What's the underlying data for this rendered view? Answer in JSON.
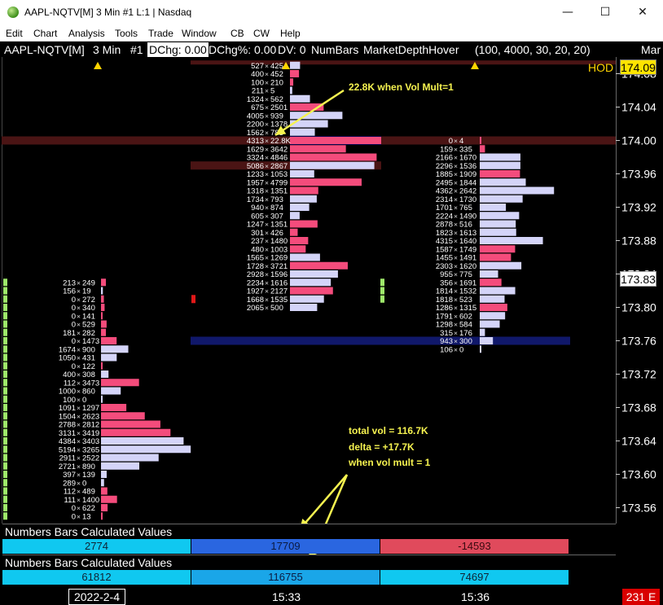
{
  "window": {
    "title": "AAPL-NQTV[M]  3 Min  #1 L:1 | Nasdaq",
    "minimize": "—",
    "maximize": "☐",
    "close": "✕"
  },
  "menu": [
    "Edit",
    "Chart",
    "Analysis",
    "Tools",
    "Trade",
    "Window",
    "CB",
    "CW",
    "Help"
  ],
  "infobar": {
    "symbol": "AAPL-NQTV[M]",
    "interval": "3 Min",
    "chart_num": "#1",
    "dchg": "DChg: 0.00",
    "dchg_pct": "DChg%: 0.00",
    "dv": "DV: 0",
    "study": "NumBars",
    "study2": "MarketDepthHover",
    "params": "(100, 4000, 30, 20, 20)",
    "trailing": "Mar"
  },
  "price_axis": {
    "labels": [
      "174.08",
      "174.04",
      "174.00",
      "173.96",
      "173.92",
      "173.88",
      "173.84",
      "173.80",
      "173.76",
      "173.72",
      "173.68",
      "173.64",
      "173.60",
      "173.56"
    ],
    "hod_label": "HOD",
    "hod_price": "174.09",
    "current_price": "173.83"
  },
  "colors": {
    "ask_bar": "#f44c7c",
    "bid_bar": "#d4d4f8",
    "poc_row": "#4a1414",
    "blue_row": "#0a0aa0",
    "navy_row": "#10186a",
    "cyan": "#10c8f0",
    "blue": "#2a66e0",
    "red": "#e04a5c",
    "green": "#9ee86a",
    "marker": "#ffd400"
  },
  "chart_data": {
    "type": "table",
    "price_step": 0.01,
    "bars": [
      {
        "time": "2022-2-4",
        "top_price": 173.83,
        "rows": [
          [
            "213",
            "249"
          ],
          [
            "156",
            "19"
          ],
          [
            "0",
            "272"
          ],
          [
            "0",
            "340"
          ],
          [
            "0",
            "141"
          ],
          [
            "0",
            "529"
          ],
          [
            "181",
            "282"
          ],
          [
            "0",
            "1473"
          ],
          [
            "1674",
            "900"
          ],
          [
            "1050",
            "431"
          ],
          [
            "0",
            "122"
          ],
          [
            "400",
            "308"
          ],
          [
            "112",
            "3473"
          ],
          [
            "1000",
            "860"
          ],
          [
            "100",
            "0"
          ],
          [
            "1091",
            "1297"
          ],
          [
            "1504",
            "2623"
          ],
          [
            "2788",
            "2812"
          ],
          [
            "3131",
            "3419"
          ],
          [
            "4384",
            "3403"
          ],
          [
            "5194",
            "3265"
          ],
          [
            "2911",
            "2522"
          ],
          [
            "2721",
            "890"
          ],
          [
            "397",
            "139"
          ],
          [
            "289",
            "0"
          ],
          [
            "112",
            "489"
          ],
          [
            "111",
            "1400"
          ],
          [
            "0",
            "622"
          ],
          [
            "0",
            "13"
          ]
        ]
      },
      {
        "time": "15:33",
        "top_price": 174.09,
        "rows": [
          [
            "527",
            "425"
          ],
          [
            "400",
            "452"
          ],
          [
            "100",
            "210"
          ],
          [
            "211",
            "5"
          ],
          [
            "1324",
            "562"
          ],
          [
            "675",
            "2501"
          ],
          [
            "4005",
            "939"
          ],
          [
            "2200",
            "1378"
          ],
          [
            "1562",
            "783"
          ],
          [
            "4313",
            "22.8K"
          ],
          [
            "1629",
            "3642"
          ],
          [
            "3324",
            "4846"
          ],
          [
            "5086",
            "2867"
          ],
          [
            "1233",
            "1053"
          ],
          [
            "1957",
            "4799"
          ],
          [
            "1318",
            "1351"
          ],
          [
            "1734",
            "793"
          ],
          [
            "940",
            "874"
          ],
          [
            "605",
            "307"
          ],
          [
            "1247",
            "1351"
          ],
          [
            "301",
            "426"
          ],
          [
            "237",
            "1480"
          ],
          [
            "480",
            "1003"
          ],
          [
            "1565",
            "1269"
          ],
          [
            "1728",
            "3721"
          ],
          [
            "2928",
            "1596"
          ],
          [
            "2234",
            "1616"
          ],
          [
            "1927",
            "2127"
          ],
          [
            "1668",
            "1535"
          ],
          [
            "2065",
            "500"
          ]
        ]
      },
      {
        "time": "15:36",
        "top_price": 174.0,
        "rows": [
          [
            "0",
            "4"
          ],
          [
            "159",
            "335"
          ],
          [
            "2166",
            "1670"
          ],
          [
            "2296",
            "1536"
          ],
          [
            "1885",
            "1909"
          ],
          [
            "2495",
            "1844"
          ],
          [
            "4362",
            "2642"
          ],
          [
            "2314",
            "1730"
          ],
          [
            "1701",
            "765"
          ],
          [
            "2224",
            "1490"
          ],
          [
            "2878",
            "516"
          ],
          [
            "1823",
            "1613"
          ],
          [
            "4315",
            "1640"
          ],
          [
            "1587",
            "1749"
          ],
          [
            "1455",
            "1491"
          ],
          [
            "2303",
            "1620"
          ],
          [
            "955",
            "775"
          ],
          [
            "356",
            "1691"
          ],
          [
            "1814",
            "1532"
          ],
          [
            "1818",
            "523"
          ],
          [
            "1286",
            "1315"
          ],
          [
            "1791",
            "602"
          ],
          [
            "1298",
            "584"
          ],
          [
            "315",
            "176"
          ],
          [
            "943",
            "300"
          ],
          [
            "106",
            "0"
          ]
        ]
      }
    ]
  },
  "annotations": {
    "vol_mult_note": "22.8K when Vol Mult=1",
    "total_vol": "total vol = 116.7K",
    "delta": "delta = +17.7K",
    "vol_mult": "when vol mult = 1"
  },
  "numbers_bars": {
    "title1": "Numbers Bars Calculated Values",
    "title2": "Numbers Bars Calculated Values",
    "row1": [
      "2774",
      "17709",
      "-14593"
    ],
    "row2": [
      "61812",
      "116755",
      "74697"
    ]
  },
  "x_axis": {
    "date": "2022-2-4",
    "t1": "15:33",
    "t2": "15:36",
    "badge": "231 E"
  }
}
